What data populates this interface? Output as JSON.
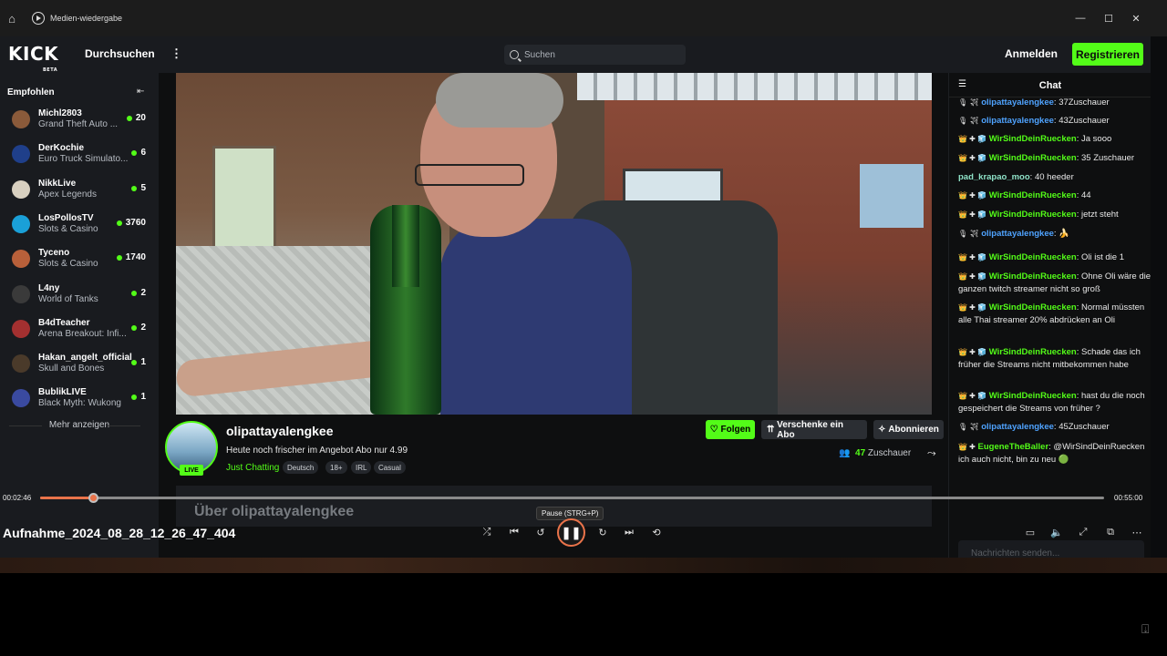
{
  "window": {
    "title": "Medien-wiedergabe",
    "controls": [
      "—",
      "☐",
      "✕"
    ]
  },
  "nav": {
    "logo": "KICK",
    "logo_sub": "BETA",
    "browse": "Durchsuchen",
    "search_placeholder": "Suchen",
    "login": "Anmelden",
    "register": "Registrieren"
  },
  "sidebar": {
    "heading": "Empfohlen",
    "more": "Mehr anzeigen",
    "channels": [
      {
        "name": "Michl2803",
        "category": "Grand Theft Auto ...",
        "viewers": "20",
        "avatar_color": "#8a5a3a"
      },
      {
        "name": "DerKochie",
        "category": "Euro Truck Simulato...",
        "viewers": "6",
        "avatar_color": "#1f3f8a"
      },
      {
        "name": "NikkLive",
        "category": "Apex Legends",
        "viewers": "5",
        "avatar_color": "#d8d0c0"
      },
      {
        "name": "LosPollosTV",
        "category": "Slots & Casino",
        "viewers": "3760",
        "avatar_color": "#1aa0d8"
      },
      {
        "name": "Tyceno",
        "category": "Slots & Casino",
        "viewers": "1740",
        "avatar_color": "#b8603a"
      },
      {
        "name": "L4ny",
        "category": "World of Tanks",
        "viewers": "2",
        "avatar_color": "#3a3a3a"
      },
      {
        "name": "B4dTeacher",
        "category": "Arena Breakout: Infi...",
        "viewers": "2",
        "avatar_color": "#a33030"
      },
      {
        "name": "Hakan_angelt_official",
        "category": "Skull and Bones",
        "viewers": "1",
        "avatar_color": "#4a3a2a"
      },
      {
        "name": "BublikLIVE",
        "category": "Black Myth: Wukong",
        "viewers": "1",
        "avatar_color": "#3a4aa0"
      }
    ]
  },
  "channel": {
    "name": "olipattayalengkee",
    "title": "Heute noch frischer im Angebot Abo nur 4.99",
    "category": "Just Chatting",
    "tags": [
      "Deutsch",
      "18+",
      "IRL",
      "Casual"
    ],
    "live": "LIVE",
    "follow": "Folgen",
    "gift": "Verschenke ein Abo",
    "subscribe": "Abonnieren",
    "viewers": "47",
    "viewers_label": "Zuschauer",
    "about": "Über olipattayalengkee"
  },
  "chat": {
    "title": "Chat",
    "input_placeholder": "Nachrichten senden...",
    "messages": [
      {
        "badges": "🎙 ✈",
        "user": "olipattayalengkee",
        "color": "#4fa3ff",
        "text": ": 37Zuschauer"
      },
      {
        "badges": "🎙 ✈",
        "user": "olipattayalengkee",
        "color": "#4fa3ff",
        "text": ": 43Zuschauer"
      },
      {
        "badges": "👑 ✚ 🧊",
        "user": "WirSindDeinRuecken",
        "color": "#53fc18",
        "text": ": Ja sooo"
      },
      {
        "badges": "👑 ✚ 🧊",
        "user": "WirSindDeinRuecken",
        "color": "#53fc18",
        "text": ": 35 Zuschauer"
      },
      {
        "badges": "",
        "user": "pad_krapao_moo",
        "color": "#8fe3c8",
        "text": ": 40 heeder"
      },
      {
        "badges": "👑 ✚ 🧊",
        "user": "WirSindDeinRuecken",
        "color": "#53fc18",
        "text": ": 44"
      },
      {
        "badges": "👑 ✚ 🧊",
        "user": "WirSindDeinRuecken",
        "color": "#53fc18",
        "text": ": jetzt steht"
      },
      {
        "badges": "🎙 ✈",
        "user": "olipattayalengkee",
        "color": "#4fa3ff",
        "text": ": 🍌"
      },
      {
        "badges": "👑 ✚ 🧊",
        "user": "WirSindDeinRuecken",
        "color": "#53fc18",
        "text": ": Oli ist die 1"
      },
      {
        "badges": "👑 ✚ 🧊",
        "user": "WirSindDeinRuecken",
        "color": "#53fc18",
        "text": ": Ohne Oli wäre die ganzen twitch streamer nicht so groß"
      },
      {
        "badges": "👑 ✚ 🧊",
        "user": "WirSindDeinRuecken",
        "color": "#53fc18",
        "text": ": Normal müssten alle Thai streamer 20% abdrücken an Oli"
      },
      {
        "badges": "👑 ✚ 🧊",
        "user": "WirSindDeinRuecken",
        "color": "#53fc18",
        "text": ": Schade das ich früher die Streams nicht mitbekommen habe"
      },
      {
        "badges": "👑 ✚ 🧊",
        "user": "WirSindDeinRuecken",
        "color": "#53fc18",
        "text": ": hast du die noch gespeichert die Streams von früher ?"
      },
      {
        "badges": "🎙 ✈",
        "user": "olipattayalengkee",
        "color": "#4fa3ff",
        "text": ": 45Zuschauer"
      },
      {
        "badges": "👑 ✚",
        "user": "EugeneTheBaller",
        "color": "#53fc18",
        "text": ": @WirSindDeinRuecken ich auch nicht, bin zu neu 🟢"
      }
    ]
  },
  "player": {
    "time_elapsed": "00:02:46",
    "time_total": "00:55:00",
    "progress_fraction": 0.05,
    "file_name": "Aufnahme_2024_08_28_12_26_47_404",
    "tooltip": "Pause (STRG+P)"
  },
  "colors": {
    "kick_green": "#53fc18",
    "accent": "#e9734a"
  }
}
